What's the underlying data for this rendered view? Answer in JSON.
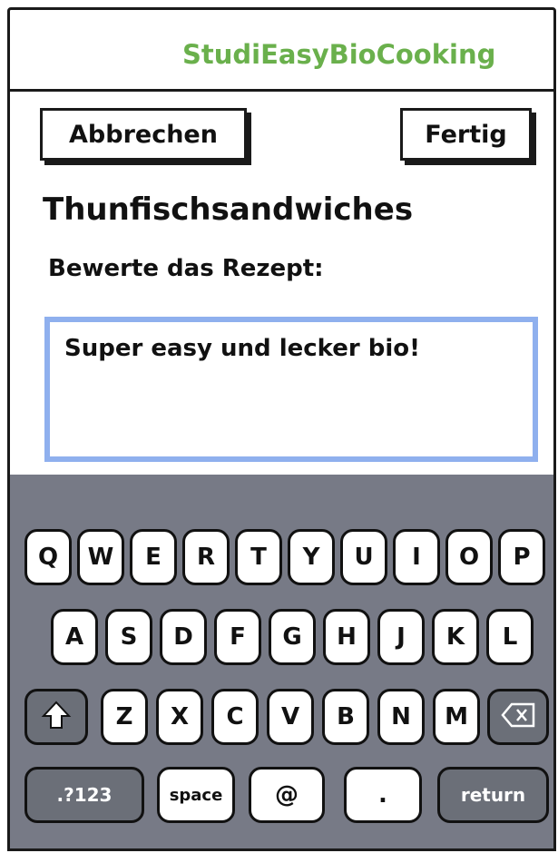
{
  "colors": {
    "accent": "#6ab04c",
    "focus": "#8fb0ee",
    "keyboard_bg": "#777a86"
  },
  "header": {
    "app_title": "StudiEasyBioCooking"
  },
  "actions": {
    "cancel_label": "Abbrechen",
    "done_label": "Fertig"
  },
  "recipe": {
    "title": "Thunfischsandwiches"
  },
  "review": {
    "prompt": "Bewerte das Rezept:",
    "text": "Super easy und lecker bio!"
  },
  "keyboard": {
    "row1": [
      "Q",
      "W",
      "E",
      "R",
      "T",
      "Y",
      "U",
      "I",
      "O",
      "P"
    ],
    "row2": [
      "A",
      "S",
      "D",
      "F",
      "G",
      "H",
      "J",
      "K",
      "L"
    ],
    "row3": [
      "Z",
      "X",
      "C",
      "V",
      "B",
      "N",
      "M"
    ],
    "shift_icon": "shift-arrow-icon",
    "backspace_icon": "backspace-icon",
    "numbers_label": ".?123",
    "space_label": "space",
    "at_label": "@",
    "dot_label": ".",
    "return_label": "return"
  }
}
